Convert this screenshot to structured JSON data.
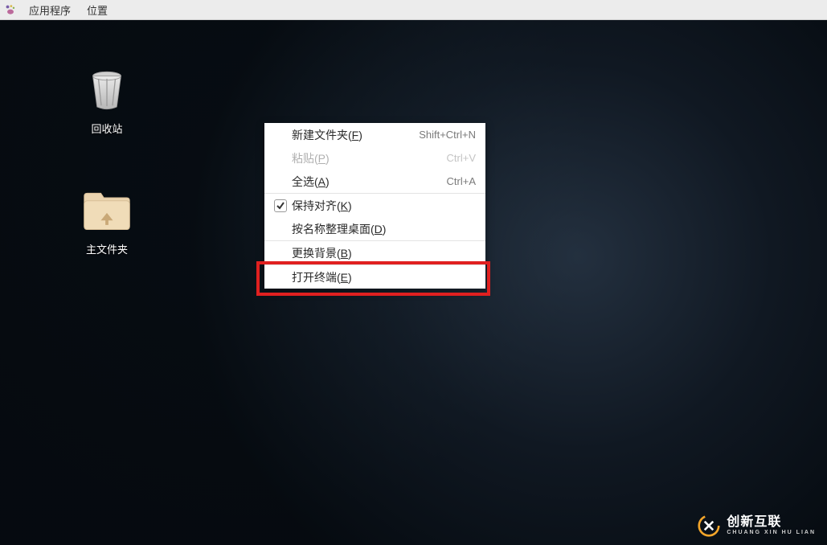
{
  "menubar": {
    "apps": "应用程序",
    "places": "位置"
  },
  "desktop": {
    "trash_label": "回收站",
    "home_label": "主文件夹"
  },
  "menu": {
    "new_folder": "新建文件夹(",
    "new_folder_mn": "F",
    "new_folder_end": ")",
    "new_folder_shortcut": "Shift+Ctrl+N",
    "paste": "粘贴(",
    "paste_mn": "P",
    "paste_end": ")",
    "paste_shortcut": "Ctrl+V",
    "select_all": "全选(",
    "select_all_mn": "A",
    "select_all_end": ")",
    "select_all_shortcut": "Ctrl+A",
    "keep_aligned": "保持对齐(",
    "keep_aligned_mn": "K",
    "keep_aligned_end": ")",
    "organize_by_name": "按名称整理桌面(",
    "organize_by_name_mn": "D",
    "organize_by_name_end": ")",
    "change_bg": "更换背景(",
    "change_bg_mn": "B",
    "change_bg_end": ")",
    "open_terminal": "打开终端(",
    "open_terminal_mn": "E",
    "open_terminal_end": ")"
  },
  "watermark": {
    "main": "创新互联",
    "sub": "CHUANG XIN HU LIAN"
  }
}
